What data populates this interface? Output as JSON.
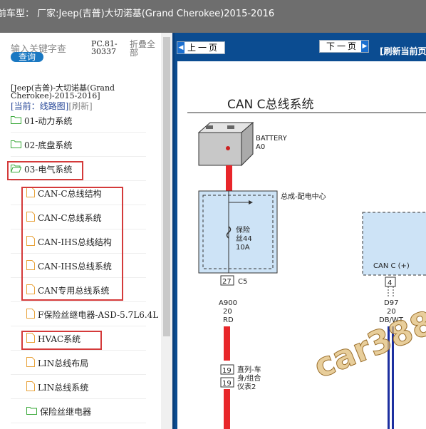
{
  "title_bar": {
    "text": "前车型：  厂家:Jeep(吉普)大切诺基(Grand Cherokee)2015-2016"
  },
  "search": {
    "placeholder": "输入关键字查",
    "button": "查询"
  },
  "pc_code": "PC.81-30337",
  "collapse_label": "折叠全部",
  "vehicle_name": "[Jeep(吉普)-大切诺基(Grand Cherokee)-2015-2016]",
  "current": {
    "label": "[当前：线路图]",
    "refresh": "[刷新]"
  },
  "tree": [
    {
      "label": "01-动力系统",
      "type": "folder"
    },
    {
      "label": "02-底盘系统",
      "type": "folder"
    },
    {
      "label": "03-电气系统",
      "type": "folder-open"
    },
    {
      "label": "CAN-C总线结构",
      "type": "file"
    },
    {
      "label": "CAN-C总线系统",
      "type": "file"
    },
    {
      "label": "CAN-IHS总线结构",
      "type": "file"
    },
    {
      "label": "CAN-IHS总线系统",
      "type": "file"
    },
    {
      "label": "CAN专用总线系统",
      "type": "file"
    },
    {
      "label": "F保险丝继电器-ASD-5.7L6.4L",
      "type": "file"
    },
    {
      "label": "HVAC系统",
      "type": "file"
    },
    {
      "label": "LIN总线布局",
      "type": "file"
    },
    {
      "label": "LIN总线系统",
      "type": "file"
    },
    {
      "label": "保险丝继电器",
      "type": "folder"
    }
  ],
  "nav": {
    "prev": "上一页",
    "next": "下一页",
    "refresh_page": "[刷新当前页"
  },
  "diagram": {
    "title": "CAN C总线系统",
    "battery_label": "BATTERY",
    "battery_code": "A0",
    "pdc_label": "总成-配电中心",
    "fuse_label_1": "保险",
    "fuse_label_2": "丝44",
    "fuse_amp": "10A",
    "pin_27": "27",
    "conn_c5": "C5",
    "wire_a900": "A900",
    "wire_gauge_1": "20",
    "wire_color_1": "RD",
    "can_c_plus": "CAN C (+)",
    "pin_4": "4",
    "wire_d97": "D97",
    "wire_gauge_2": "20",
    "wire_color_2": "DB/WT",
    "pin_19a": "19",
    "pin_19b": "19",
    "cluster_1": "直列-车",
    "cluster_2": "身/组合",
    "cluster_3": "仪表2",
    "watermark": "car388"
  },
  "colors": {
    "accent": "#0b4c91",
    "highlight_box": "#d43a3a",
    "wire_red": "#e8262a",
    "folder_green": "#3aa93a",
    "file_orange": "#e8a23a"
  }
}
